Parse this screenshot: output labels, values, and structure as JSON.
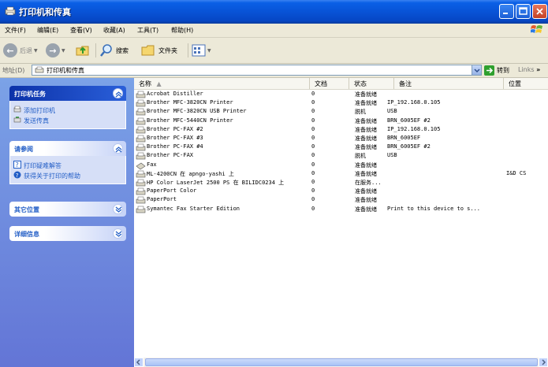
{
  "window": {
    "title": "打印机和传真"
  },
  "menu": [
    "文件(F)",
    "编辑(E)",
    "查看(V)",
    "收藏(A)",
    "工具(T)",
    "帮助(H)"
  ],
  "toolbar": {
    "back_label": "后退",
    "search_label": "搜索",
    "folders_label": "文件夹"
  },
  "address": {
    "label": "地址(D)",
    "value": "打印机和传真",
    "go_label": "转到",
    "links_label": "Links"
  },
  "task_pane": {
    "printer_tasks": {
      "title": "打印机任务",
      "items": [
        "添加打印机",
        "发送传真"
      ]
    },
    "see_also": {
      "title": "请参阅",
      "items": [
        "打印疑难解答",
        "获得关于打印的帮助"
      ]
    },
    "other_places": {
      "title": "其它位置"
    },
    "details": {
      "title": "详细信息"
    }
  },
  "list": {
    "columns": [
      "名称",
      "文档",
      "状态",
      "备注",
      "位置"
    ],
    "rows": [
      {
        "name": "Acrobat Distiller",
        "docs": "0",
        "status": "准备就绪",
        "comment": "",
        "location": ""
      },
      {
        "name": "Brother MFC-3820CN Printer",
        "docs": "0",
        "status": "准备就绪",
        "comment": "IP_192.168.0.105",
        "location": ""
      },
      {
        "name": "Brother MFC-3820CN USB Printer",
        "docs": "0",
        "status": "脱机",
        "comment": "USB",
        "location": ""
      },
      {
        "name": "Brother MFC-5440CN Printer",
        "docs": "0",
        "status": "准备就绪",
        "comment": "BRN_6005EF #2",
        "location": ""
      },
      {
        "name": "Brother PC-FAX #2",
        "docs": "0",
        "status": "准备就绪",
        "comment": "IP_192.168.0.105",
        "location": ""
      },
      {
        "name": "Brother PC-FAX #3",
        "docs": "0",
        "status": "准备就绪",
        "comment": "BRN_6005EF",
        "location": ""
      },
      {
        "name": "Brother PC-FAX #4",
        "docs": "0",
        "status": "准备就绪",
        "comment": "BRN_6005EF #2",
        "location": ""
      },
      {
        "name": "Brother PC-FAX",
        "docs": "0",
        "status": "脱机",
        "comment": "USB",
        "location": ""
      },
      {
        "name": "Fax",
        "docs": "0",
        "status": "准备就绪",
        "comment": "",
        "location": ""
      },
      {
        "name": "ML-4200CN 在 apngo-yashi 上",
        "docs": "0",
        "status": "准备就绪",
        "comment": "",
        "location": "I&D CS"
      },
      {
        "name": "HP Color LaserJet 2500 PS 在 BILIDC0234 上",
        "docs": "0",
        "status": "在服务...",
        "comment": "",
        "location": ""
      },
      {
        "name": "PaperPort Color",
        "docs": "0",
        "status": "准备就绪",
        "comment": "",
        "location": ""
      },
      {
        "name": "PaperPort",
        "docs": "0",
        "status": "准备就绪",
        "comment": "",
        "location": ""
      },
      {
        "name": "Symantec Fax Starter Edition",
        "docs": "0",
        "status": "准备就绪",
        "comment": "Print to this device to s...",
        "location": ""
      }
    ]
  },
  "colors": {
    "titlebar": "#0853d6",
    "taskpane_top": "#7ba2e7",
    "taskpane_bottom": "#6375d6",
    "link": "#215dc6"
  },
  "icons": {
    "printer": "printer-icon",
    "fax": "fax-icon"
  }
}
